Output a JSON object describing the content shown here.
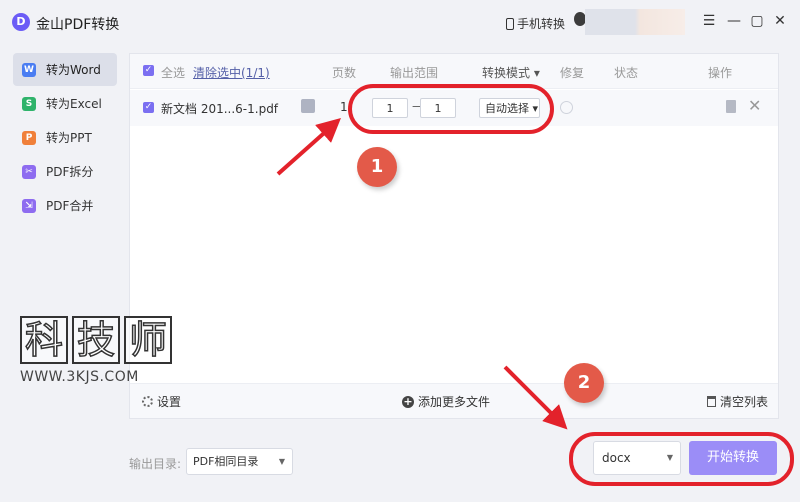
{
  "app": {
    "title": "金山PDF转换",
    "logo_glyph": "D"
  },
  "titlebar": {
    "phone_label": "手机转换",
    "menu_glyph": "☰",
    "min_glyph": "—",
    "max_glyph": "▢",
    "close_glyph": "✕"
  },
  "sidebar": {
    "items": [
      {
        "label": "转为Word",
        "icon": "word-icon",
        "glyph": "W",
        "color": "#4a7df2",
        "active": true
      },
      {
        "label": "转为Excel",
        "icon": "excel-icon",
        "glyph": "S",
        "color": "#2fb36b"
      },
      {
        "label": "转为PPT",
        "icon": "ppt-icon",
        "glyph": "P",
        "color": "#f0803a"
      },
      {
        "label": "PDF拆分",
        "icon": "split-icon",
        "glyph": "✂",
        "color": "#8e6cf0"
      },
      {
        "label": "PDF合并",
        "icon": "merge-icon",
        "glyph": "⇲",
        "color": "#8e6cf0"
      }
    ]
  },
  "table": {
    "header": {
      "select_all": "全选",
      "clear_selected": "清除选中(1/1)",
      "pages": "页数",
      "range": "输出范围",
      "mode": "转换模式",
      "repair": "修复",
      "status": "状态",
      "ops": "操作"
    },
    "rows": [
      {
        "name": "新文档 201...6-1.pdf",
        "pages": "1",
        "range_from": "1",
        "range_to": "1",
        "range_sep": "—",
        "mode": "自动选择"
      }
    ]
  },
  "footer": {
    "settings": "设置",
    "add_more": "添加更多文件",
    "clear_list": "清空列表"
  },
  "bottom": {
    "output_label": "输出目录:",
    "output_value": "PDF相同目录",
    "format": "docx",
    "start": "开始转换"
  },
  "annotations": {
    "badge1": "1",
    "badge2": "2"
  },
  "watermark": {
    "c1": "科",
    "c2": "技",
    "c3": "师",
    "url": "WWW.3KJS.COM"
  },
  "colors": {
    "accent": "#7b6ff1",
    "button": "#9b8df7",
    "annotation": "#e3222b"
  }
}
